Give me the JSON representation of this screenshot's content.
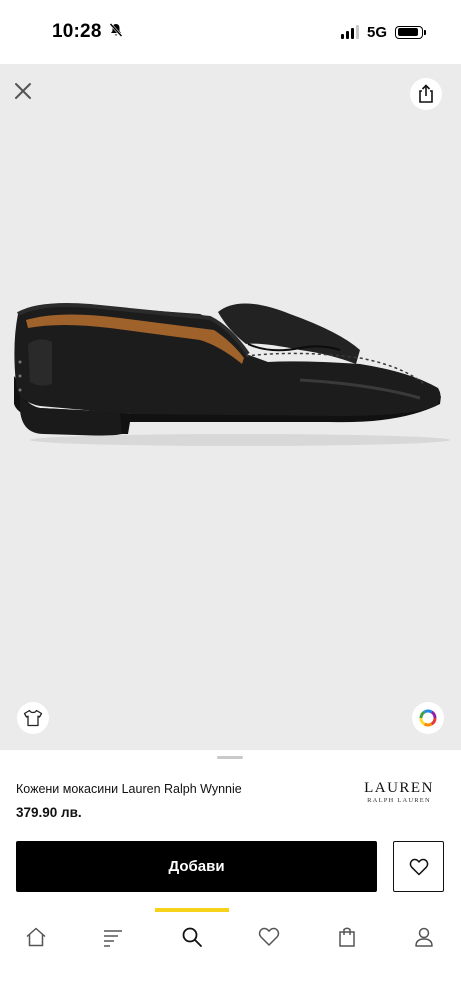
{
  "status_bar": {
    "time": "10:28",
    "network": "5G",
    "icons": [
      "bell-slash-icon",
      "signal-bars-icon",
      "battery-icon"
    ],
    "battery_level": 0.9
  },
  "header": {
    "close_icon": "close-icon",
    "share_icon": "share-icon"
  },
  "product": {
    "name": "Кожени мокасини Lauren Ralph Wynnie",
    "price": "379.90 лв.",
    "brand_main": "LAUREN",
    "brand_sub": "RALPH LAUREN",
    "image_background": "#ebebeb",
    "size_icon": "tshirt-icon",
    "color_icon": "color-wheel-icon"
  },
  "actions": {
    "add_label": "Добави",
    "wishlist_icon": "heart-icon"
  },
  "tabs": [
    {
      "icon": "home-icon"
    },
    {
      "icon": "menu-icon"
    },
    {
      "icon": "search-icon",
      "active": true
    },
    {
      "icon": "heart-icon"
    },
    {
      "icon": "bag-icon"
    },
    {
      "icon": "profile-icon"
    }
  ],
  "colors": {
    "accent": "#f7d21a",
    "primary": "#000000"
  }
}
